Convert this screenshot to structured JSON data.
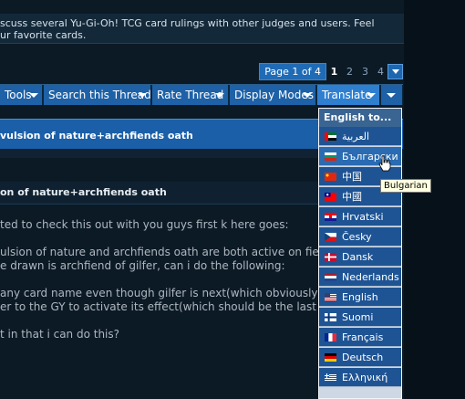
{
  "header": {
    "lines": [
      "scuss several Yu-Gi-Oh! TCG card rulings with other judges and users. Feel",
      "ur favorite cards."
    ]
  },
  "pagination": {
    "label": "Page 1 of 4",
    "pages": [
      "1",
      "2",
      "3",
      "4"
    ],
    "current": "1",
    "next": "›"
  },
  "toolbar": {
    "tools": "Tools",
    "search": "Search this Thread",
    "rate": "Rate Thread",
    "display": "Display Modes",
    "translate": "Translate"
  },
  "thread": {
    "title": "vulsion of nature+archfiends oath",
    "post_title": "on of nature+archfiends oath"
  },
  "post": {
    "lines": [
      "ted to check this out with you guys first k here goes:",
      "",
      "ulsion of nature and archfiends oath are both active on field a",
      "e drawn is archfiend of gilfer, can i do the following:",
      "",
      "any card name even though gilfer is next(which obviously i kn",
      "er to the GY to activate its effect(which should be the last thin",
      "",
      "t in that i can do this?"
    ]
  },
  "translate_menu": {
    "header": "English to...",
    "languages": [
      {
        "label": "العربية",
        "flag": "flag-ae"
      },
      {
        "label": "Български",
        "flag": "flag-bg"
      },
      {
        "label": "中国",
        "flag": "flag-cn"
      },
      {
        "label": "中國",
        "flag": "flag-tw"
      },
      {
        "label": "Hrvatski",
        "flag": "flag-hr"
      },
      {
        "label": "Česky",
        "flag": "flag-cz"
      },
      {
        "label": "Dansk",
        "flag": "flag-dk"
      },
      {
        "label": "Nederlands",
        "flag": "flag-nl"
      },
      {
        "label": "English",
        "flag": "flag-us"
      },
      {
        "label": "Suomi",
        "flag": "flag-fi"
      },
      {
        "label": "Français",
        "flag": "flag-fr"
      },
      {
        "label": "Deutsch",
        "flag": "flag-de"
      },
      {
        "label": "Ελληνική",
        "flag": "flag-gr"
      }
    ]
  },
  "tooltip": "Bulgarian",
  "colors": {
    "background": "#0c1a26",
    "toolbar_button": "#1e61a6",
    "thread_band": "#1a5fa8",
    "menu_item": "#1e5494"
  }
}
